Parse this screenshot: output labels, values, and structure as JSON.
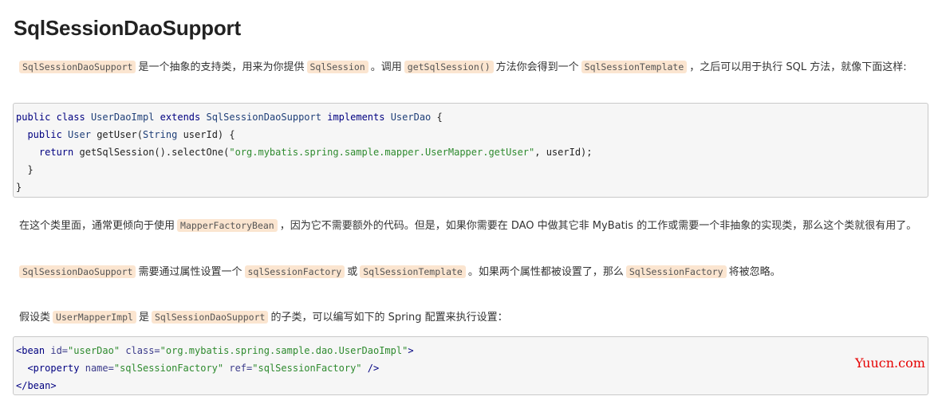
{
  "title": "SqlSessionDaoSupport",
  "para1": {
    "code1": "SqlSessionDaoSupport",
    "t1": "是一个抽象的支持类，用来为你提供",
    "code2": "SqlSession",
    "t2": "。调用",
    "code3": "getSqlSession()",
    "t3": "方法你会得到一个",
    "code4": "SqlSessionTemplate",
    "t4": "，之后可以用于执行 SQL 方法，就像下面这样:"
  },
  "code1": {
    "l1_kw1": "public",
    "l1_kw2": "class",
    "l1_name": "UserDaoImpl",
    "l1_kw3": "extends",
    "l1_sup": "SqlSessionDaoSupport",
    "l1_kw4": "implements",
    "l1_iface": "UserDao",
    "l1_brace": "{",
    "l2_kw1": "public",
    "l2_type": "User",
    "l2_method": "getUser(",
    "l2_ptype": "String",
    "l2_param": "userId) {",
    "l3_kw": "return",
    "l3_call": "getSqlSession().selectOne(",
    "l3_str": "\"org.mybatis.spring.sample.mapper.UserMapper.getUser\"",
    "l3_rest": ", userId);",
    "l4": "}",
    "l5": "}"
  },
  "para2": {
    "t1": "在这个类里面，通常更倾向于使用",
    "code1": "MapperFactoryBean",
    "t2": "，因为它不需要额外的代码。但是，如果你需要在 DAO 中做其它非 MyBatis 的工作或需要一个非抽象的实现类，那么这个类就很有用了。"
  },
  "para3": {
    "code1": "SqlSessionDaoSupport",
    "t1": "需要通过属性设置一个",
    "code2": "sqlSessionFactory",
    "t2": "或",
    "code3": "SqlSessionTemplate",
    "t3": "。如果两个属性都被设置了，那么",
    "code4": "SqlSessionFactory",
    "t4": "将被忽略。"
  },
  "para4": {
    "t1": "假设类",
    "code1": "UserMapperImpl",
    "t2": "是",
    "code2": "SqlSessionDaoSupport",
    "t3": "的子类，可以编写如下的 Spring 配置来执行设置："
  },
  "code2": {
    "l1_open": "<bean",
    "l1_a1": "id=",
    "l1_v1": "\"userDao\"",
    "l1_a2": "class=",
    "l1_v2": "\"org.mybatis.spring.sample.dao.UserDaoImpl\"",
    "l1_close": ">",
    "l2_open": "<property",
    "l2_a1": "name=",
    "l2_v1": "\"sqlSessionFactory\"",
    "l2_a2": "ref=",
    "l2_v2": "\"sqlSessionFactory\"",
    "l2_close": "/>",
    "l3": "</bean>"
  },
  "watermark": "Yuucn.com",
  "colors": {
    "inline_code_bg": "#fbe5d0",
    "keyword": "#000080",
    "string": "#2e8a2e",
    "watermark": "#e60000"
  }
}
